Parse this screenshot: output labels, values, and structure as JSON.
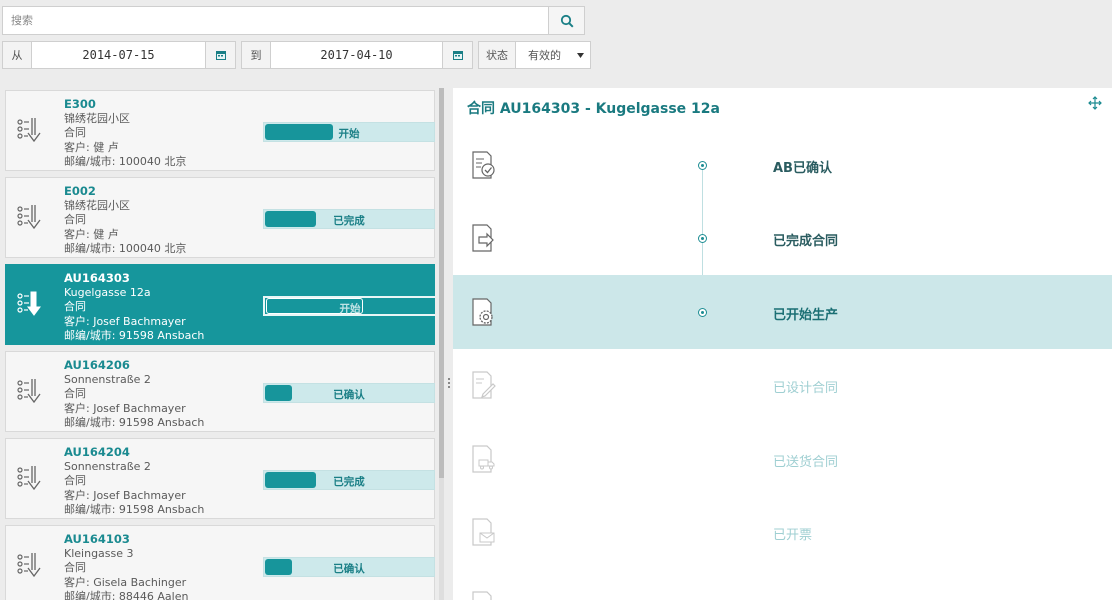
{
  "search": {
    "placeholder": "搜索"
  },
  "filters": {
    "from_label": "从",
    "from_date": "2014-07-15",
    "to_label": "到",
    "to_date": "2017-04-10",
    "status_label": "状态",
    "status_value": "有效的"
  },
  "list": {
    "items": [
      {
        "code": "E300",
        "name": "锦绣花园小区",
        "type": "合同",
        "customer": "客户: 健 卢",
        "address": "邮编/城市: 100040 北京",
        "status": "开始",
        "progress": 0.4
      },
      {
        "code": "E002",
        "name": "锦绣花园小区",
        "type": "合同",
        "customer": "客户: 健 卢",
        "address": "邮编/城市: 100040 北京",
        "status": "已完成",
        "progress": 0.3
      },
      {
        "code": "AU164303",
        "name": "Kugelgasse 12a",
        "type": "合同",
        "customer": "客户: Josef Bachmayer",
        "address": "邮编/城市: 91598 Ansbach",
        "status": "开始",
        "progress": 0.57
      },
      {
        "code": "AU164206",
        "name": "Sonnenstraße 2",
        "type": "合同",
        "customer": "客户: Josef Bachmayer",
        "address": "邮编/城市: 91598 Ansbach",
        "status": "已确认",
        "progress": 0.16
      },
      {
        "code": "AU164204",
        "name": "Sonnenstraße 2",
        "type": "合同",
        "customer": "客户: Josef Bachmayer",
        "address": "邮编/城市: 91598 Ansbach",
        "status": "已完成",
        "progress": 0.3
      },
      {
        "code": "AU164103",
        "name": "Kleingasse 3",
        "type": "合同",
        "customer": "客户: Gisela Bachinger",
        "address": "邮编/城市: 88446 Aalen",
        "status": "已确认",
        "progress": 0.16
      }
    ]
  },
  "detail": {
    "title": "合同 AU164303 - Kugelgasse 12a",
    "steps": [
      {
        "label": "AB已确认",
        "state": "done",
        "icon": "document-check-icon"
      },
      {
        "label": "已完成合同",
        "state": "done",
        "icon": "document-arrow-icon"
      },
      {
        "label": "已开始生产",
        "state": "active",
        "icon": "document-gear-icon"
      },
      {
        "label": "已设计合同",
        "state": "todo",
        "icon": "document-pencil-icon"
      },
      {
        "label": "已送货合同",
        "state": "todo",
        "icon": "document-truck-icon"
      },
      {
        "label": "已开票",
        "state": "todo",
        "icon": "document-mail-icon"
      }
    ]
  },
  "colors": {
    "accent": "#16969c",
    "active_row": "#cce7e9",
    "progress_bg": "#cde9eb"
  }
}
